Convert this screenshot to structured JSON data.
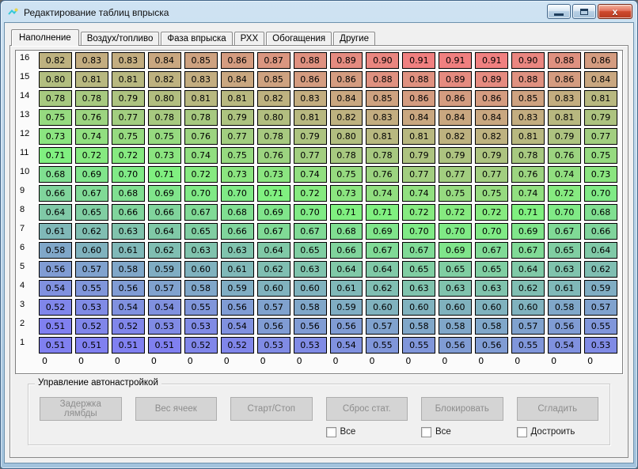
{
  "window": {
    "title": "Редактирование таблиц впрыска",
    "icons": {
      "app": "app-icon",
      "minimize": "minimize-icon",
      "maximize": "maximize-icon",
      "close": "close-icon"
    }
  },
  "tabs": [
    {
      "label": "Наполнение",
      "active": true
    },
    {
      "label": "Воздух/топливо",
      "active": false
    },
    {
      "label": "Фаза впрыска",
      "active": false
    },
    {
      "label": "РХХ",
      "active": false
    },
    {
      "label": "Обогащения",
      "active": false
    },
    {
      "label": "Другие",
      "active": false
    }
  ],
  "grid": {
    "row_labels": [
      "16",
      "15",
      "14",
      "13",
      "12",
      "11",
      "10",
      "9",
      "8",
      "7",
      "6",
      "5",
      "4",
      "3",
      "2",
      "1"
    ],
    "col_labels": [
      "0",
      "0",
      "0",
      "0",
      "0",
      "0",
      "0",
      "0",
      "0",
      "0",
      "0",
      "0",
      "0",
      "0",
      "0",
      "0"
    ],
    "values": [
      [
        "0.82",
        "0.83",
        "0.83",
        "0.84",
        "0.85",
        "0.86",
        "0.87",
        "0.88",
        "0.89",
        "0.90",
        "0.91",
        "0.91",
        "0.91",
        "0.90",
        "0.88",
        "0.86"
      ],
      [
        "0.80",
        "0.81",
        "0.81",
        "0.82",
        "0.83",
        "0.84",
        "0.85",
        "0.86",
        "0.86",
        "0.88",
        "0.88",
        "0.89",
        "0.89",
        "0.88",
        "0.86",
        "0.84"
      ],
      [
        "0.78",
        "0.78",
        "0.79",
        "0.80",
        "0.81",
        "0.81",
        "0.82",
        "0.83",
        "0.84",
        "0.85",
        "0.86",
        "0.86",
        "0.86",
        "0.85",
        "0.83",
        "0.81"
      ],
      [
        "0.75",
        "0.76",
        "0.77",
        "0.78",
        "0.78",
        "0.79",
        "0.80",
        "0.81",
        "0.82",
        "0.83",
        "0.84",
        "0.84",
        "0.84",
        "0.83",
        "0.81",
        "0.79"
      ],
      [
        "0.73",
        "0.74",
        "0.75",
        "0.75",
        "0.76",
        "0.77",
        "0.78",
        "0.79",
        "0.80",
        "0.81",
        "0.81",
        "0.82",
        "0.82",
        "0.81",
        "0.79",
        "0.77"
      ],
      [
        "0.71",
        "0.72",
        "0.72",
        "0.73",
        "0.74",
        "0.75",
        "0.76",
        "0.77",
        "0.78",
        "0.78",
        "0.79",
        "0.79",
        "0.79",
        "0.78",
        "0.76",
        "0.75"
      ],
      [
        "0.68",
        "0.69",
        "0.70",
        "0.71",
        "0.72",
        "0.73",
        "0.73",
        "0.74",
        "0.75",
        "0.76",
        "0.77",
        "0.77",
        "0.77",
        "0.76",
        "0.74",
        "0.73"
      ],
      [
        "0.66",
        "0.67",
        "0.68",
        "0.69",
        "0.70",
        "0.70",
        "0.71",
        "0.72",
        "0.73",
        "0.74",
        "0.74",
        "0.75",
        "0.75",
        "0.74",
        "0.72",
        "0.70"
      ],
      [
        "0.64",
        "0.65",
        "0.66",
        "0.66",
        "0.67",
        "0.68",
        "0.69",
        "0.70",
        "0.71",
        "0.71",
        "0.72",
        "0.72",
        "0.72",
        "0.71",
        "0.70",
        "0.68"
      ],
      [
        "0.61",
        "0.62",
        "0.63",
        "0.64",
        "0.65",
        "0.66",
        "0.67",
        "0.67",
        "0.68",
        "0.69",
        "0.70",
        "0.70",
        "0.70",
        "0.69",
        "0.67",
        "0.66"
      ],
      [
        "0.58",
        "0.60",
        "0.61",
        "0.62",
        "0.63",
        "0.63",
        "0.64",
        "0.65",
        "0.66",
        "0.67",
        "0.67",
        "0.69",
        "0.67",
        "0.67",
        "0.65",
        "0.64"
      ],
      [
        "0.56",
        "0.57",
        "0.58",
        "0.59",
        "0.60",
        "0.61",
        "0.62",
        "0.63",
        "0.64",
        "0.64",
        "0.65",
        "0.65",
        "0.65",
        "0.64",
        "0.63",
        "0.62"
      ],
      [
        "0.54",
        "0.55",
        "0.56",
        "0.57",
        "0.58",
        "0.59",
        "0.60",
        "0.60",
        "0.61",
        "0.62",
        "0.63",
        "0.63",
        "0.63",
        "0.62",
        "0.61",
        "0.59"
      ],
      [
        "0.52",
        "0.53",
        "0.54",
        "0.54",
        "0.55",
        "0.56",
        "0.57",
        "0.58",
        "0.59",
        "0.60",
        "0.60",
        "0.60",
        "0.60",
        "0.60",
        "0.58",
        "0.57"
      ],
      [
        "0.51",
        "0.52",
        "0.52",
        "0.53",
        "0.53",
        "0.54",
        "0.56",
        "0.56",
        "0.56",
        "0.57",
        "0.58",
        "0.58",
        "0.58",
        "0.57",
        "0.56",
        "0.55"
      ],
      [
        "0.51",
        "0.51",
        "0.51",
        "0.51",
        "0.52",
        "0.52",
        "0.53",
        "0.53",
        "0.54",
        "0.55",
        "0.55",
        "0.56",
        "0.56",
        "0.55",
        "0.54",
        "0.53"
      ]
    ],
    "color_scale": {
      "min": 0.51,
      "max": 0.91,
      "low": "#8080f0",
      "mid": "#80f080",
      "high": "#f08080",
      "cell_border": "#000000"
    }
  },
  "autotune": {
    "group_title": "Управление автонастройкой",
    "buttons": [
      "Задержка лямбды",
      "Вес ячеек",
      "Старт/Стоп",
      "Сброс стат.",
      "Блокировать",
      "Сгладить"
    ],
    "buttons_enabled": false,
    "checkboxes": [
      {
        "label": "Все",
        "checked": false
      },
      {
        "label": "Все",
        "checked": false
      },
      {
        "label": "Достроить",
        "checked": false
      }
    ]
  }
}
